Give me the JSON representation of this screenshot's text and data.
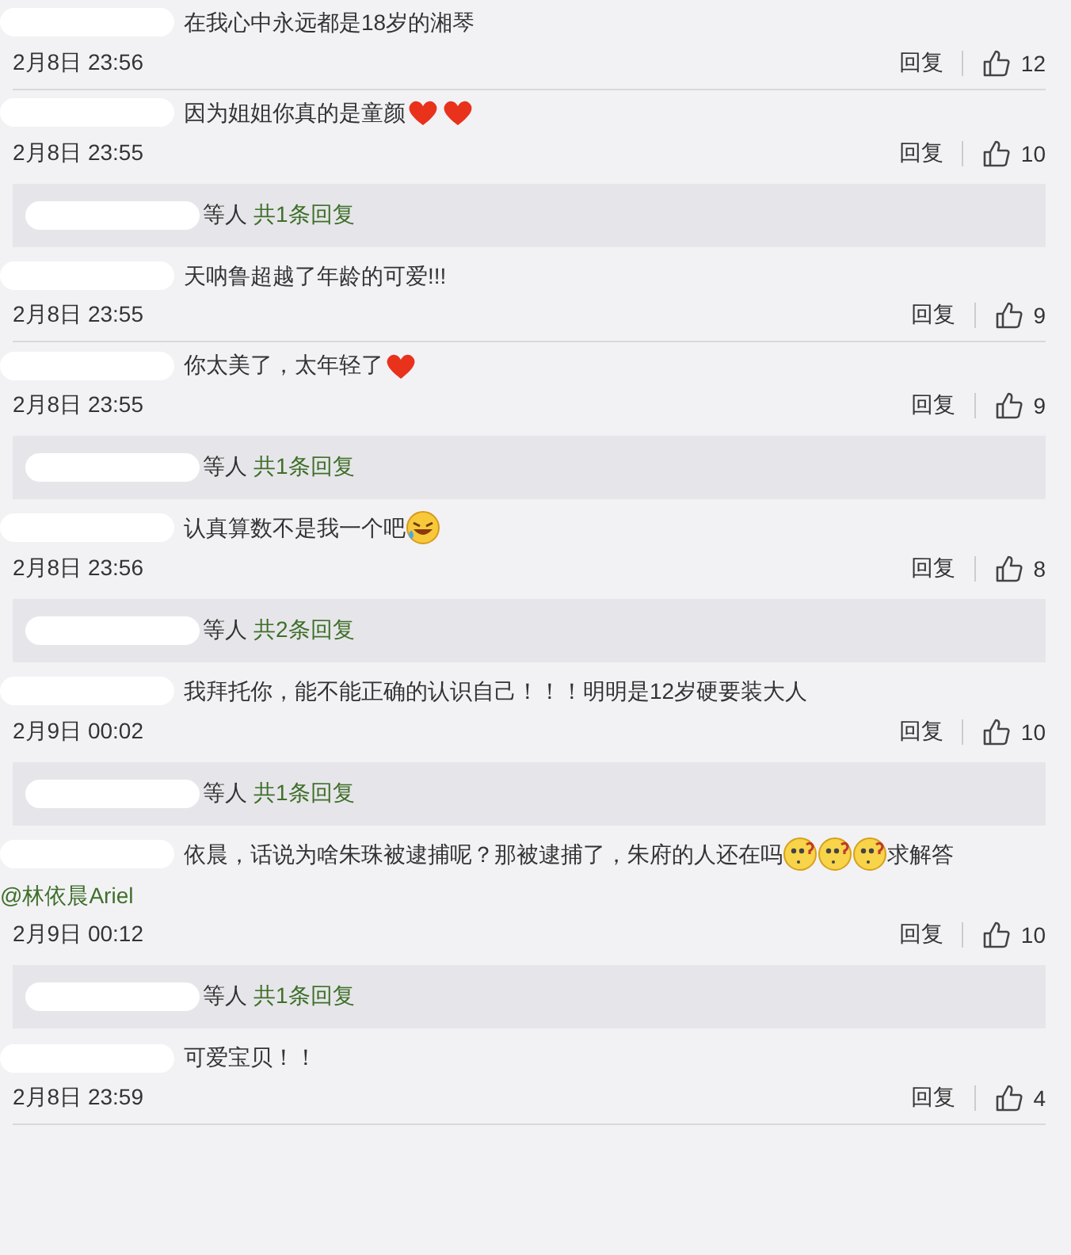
{
  "comments": [
    {
      "content": [
        {
          "kind": "text",
          "text": "在我心中永远都是18岁的湘琴"
        }
      ],
      "time": "2月8日 23:56",
      "reply": "回复",
      "likes": "12"
    },
    {
      "content": [
        {
          "kind": "text",
          "text": "因为姐姐你真的是童颜"
        },
        {
          "kind": "heart"
        },
        {
          "kind": "heart"
        }
      ],
      "time": "2月8日 23:55",
      "reply": "回复",
      "likes": "10",
      "thread": {
        "suffix": "等人",
        "link": "共1条回复"
      }
    },
    {
      "content": [
        {
          "kind": "text",
          "text": "天呐鲁超越了年龄的可爱!!!"
        }
      ],
      "time": "2月8日 23:55",
      "reply": "回复",
      "likes": "9"
    },
    {
      "content": [
        {
          "kind": "text",
          "text": "你太美了，太年轻了"
        },
        {
          "kind": "heart"
        }
      ],
      "time": "2月8日 23:55",
      "reply": "回复",
      "likes": "9",
      "thread": {
        "suffix": "等人",
        "link": "共1条回复"
      }
    },
    {
      "content": [
        {
          "kind": "text",
          "text": "认真算数不是我一个吧"
        },
        {
          "kind": "laugh"
        }
      ],
      "time": "2月8日 23:56",
      "reply": "回复",
      "likes": "8",
      "thread": {
        "suffix": "等人",
        "link": "共2条回复"
      }
    },
    {
      "content": [
        {
          "kind": "text",
          "text": "我拜托你，能不能正确的认识自己！！！明明是12岁硬要装大人"
        }
      ],
      "time": "2月9日 00:02",
      "reply": "回复",
      "likes": "10",
      "thread": {
        "suffix": "等人",
        "link": "共1条回复"
      }
    },
    {
      "content": [
        {
          "kind": "text",
          "text": "依晨，话说为啥朱珠被逮捕呢？那被逮捕了，朱府的人还在吗"
        },
        {
          "kind": "puzzled"
        },
        {
          "kind": "puzzled"
        },
        {
          "kind": "puzzled"
        },
        {
          "kind": "text",
          "text": "求解答"
        },
        {
          "kind": "mention",
          "text": "@林依晨Ariel"
        }
      ],
      "time": "2月9日 00:12",
      "reply": "回复",
      "likes": "10",
      "thread": {
        "suffix": "等人",
        "link": "共1条回复"
      }
    },
    {
      "content": [
        {
          "kind": "text",
          "text": "可爱宝贝！！"
        }
      ],
      "time": "2月8日 23:59",
      "reply": "回复",
      "likes": "4"
    }
  ]
}
